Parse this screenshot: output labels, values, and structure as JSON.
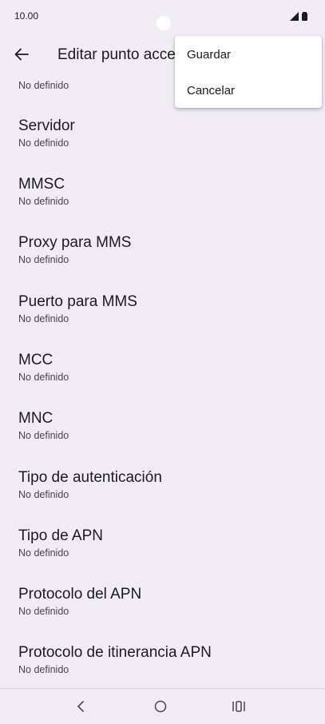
{
  "status_bar": {
    "time": "10.00",
    "icons": [
      "signal-icon",
      "battery-icon"
    ]
  },
  "app_bar": {
    "back_icon": "arrow-left-icon",
    "title": "Editar punto acce"
  },
  "overflow_menu": {
    "items": [
      {
        "label": "Guardar"
      },
      {
        "label": "Cancelar"
      }
    ]
  },
  "settings": {
    "partial_summary": "No definido",
    "items": [
      {
        "title": "Servidor",
        "summary": "No definido"
      },
      {
        "title": "MMSC",
        "summary": "No definido"
      },
      {
        "title": "Proxy para MMS",
        "summary": "No definido"
      },
      {
        "title": "Puerto para MMS",
        "summary": "No definido"
      },
      {
        "title": "MCC",
        "summary": "No definido"
      },
      {
        "title": "MNC",
        "summary": "No definido"
      },
      {
        "title": "Tipo de autenticación",
        "summary": "No definido"
      },
      {
        "title": "Tipo de APN",
        "summary": "No definido"
      },
      {
        "title": "Protocolo del APN",
        "summary": "No definido"
      },
      {
        "title": "Protocolo de itinerancia APN",
        "summary": "No definido"
      }
    ]
  },
  "nav_bar": {
    "buttons": [
      "back-nav-icon",
      "home-nav-icon",
      "recents-nav-icon"
    ]
  }
}
